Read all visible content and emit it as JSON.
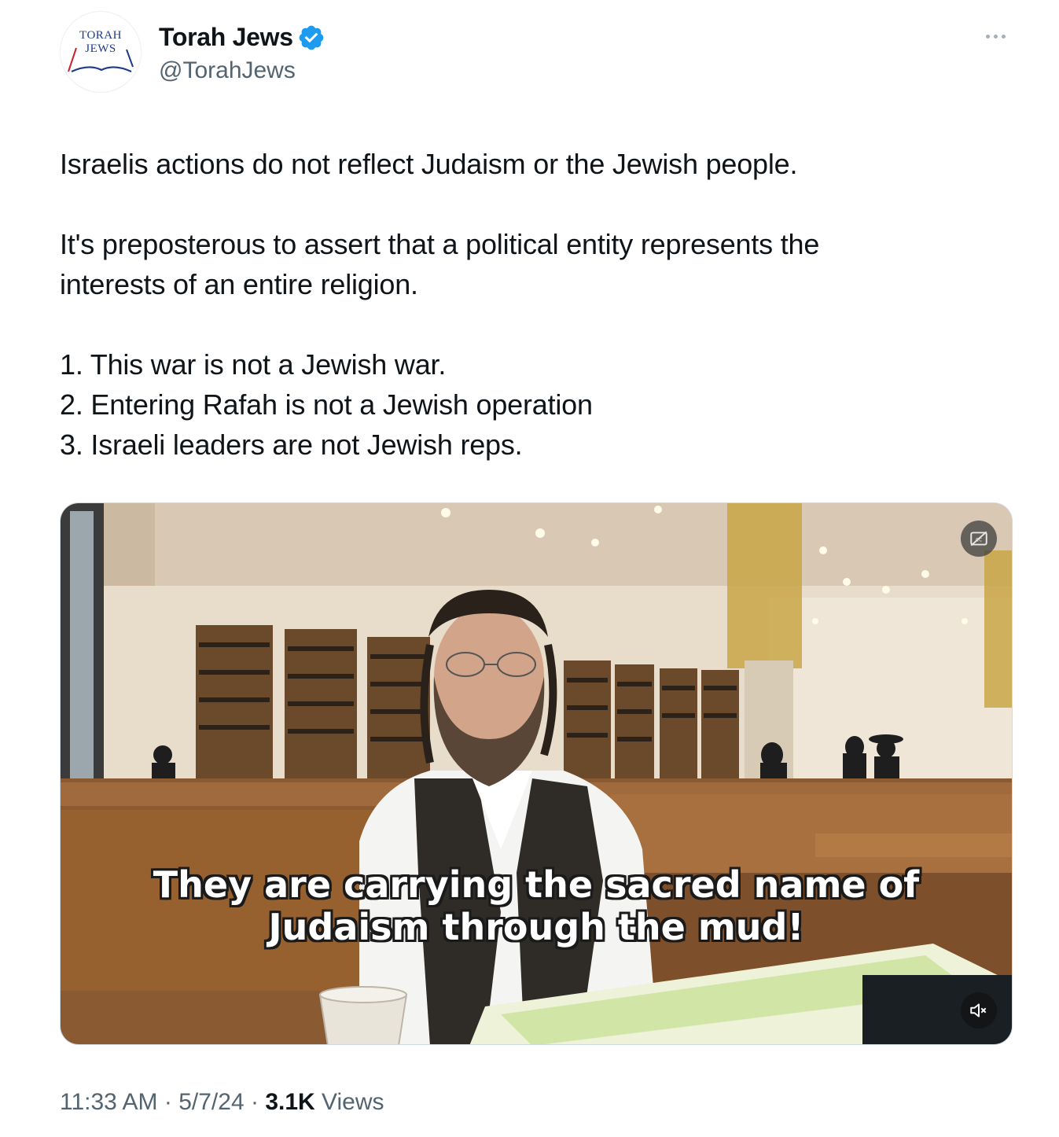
{
  "author": {
    "name": "Torah Jews",
    "handle": "@TorahJews",
    "avatar_text": "TORAH\nJEWS",
    "verified_icon": "verified-badge-icon",
    "accent_color": "#1d9bf0"
  },
  "more_icon": "more-options-icon",
  "tweet": {
    "paragraph_1": "Israelis actions do not reflect Judaism or the Jewish people.",
    "paragraph_2": "It's preposterous to assert that a political entity represents the interests of an entire religion.",
    "list": [
      "1. This war is not a Jewish war.",
      "2. Entering Rafah is not a Jewish operation",
      "3. Israeli leaders are not Jewish reps."
    ]
  },
  "video": {
    "caption": "They are carrying the sacred name of Judaism through the mud!",
    "captions_icon": "captions-off-icon",
    "mute_icon": "muted-speaker-icon"
  },
  "meta": {
    "time": "11:33 AM",
    "date": "5/7/24",
    "separator": "·",
    "views_count": "3.1K",
    "views_label": "Views"
  }
}
